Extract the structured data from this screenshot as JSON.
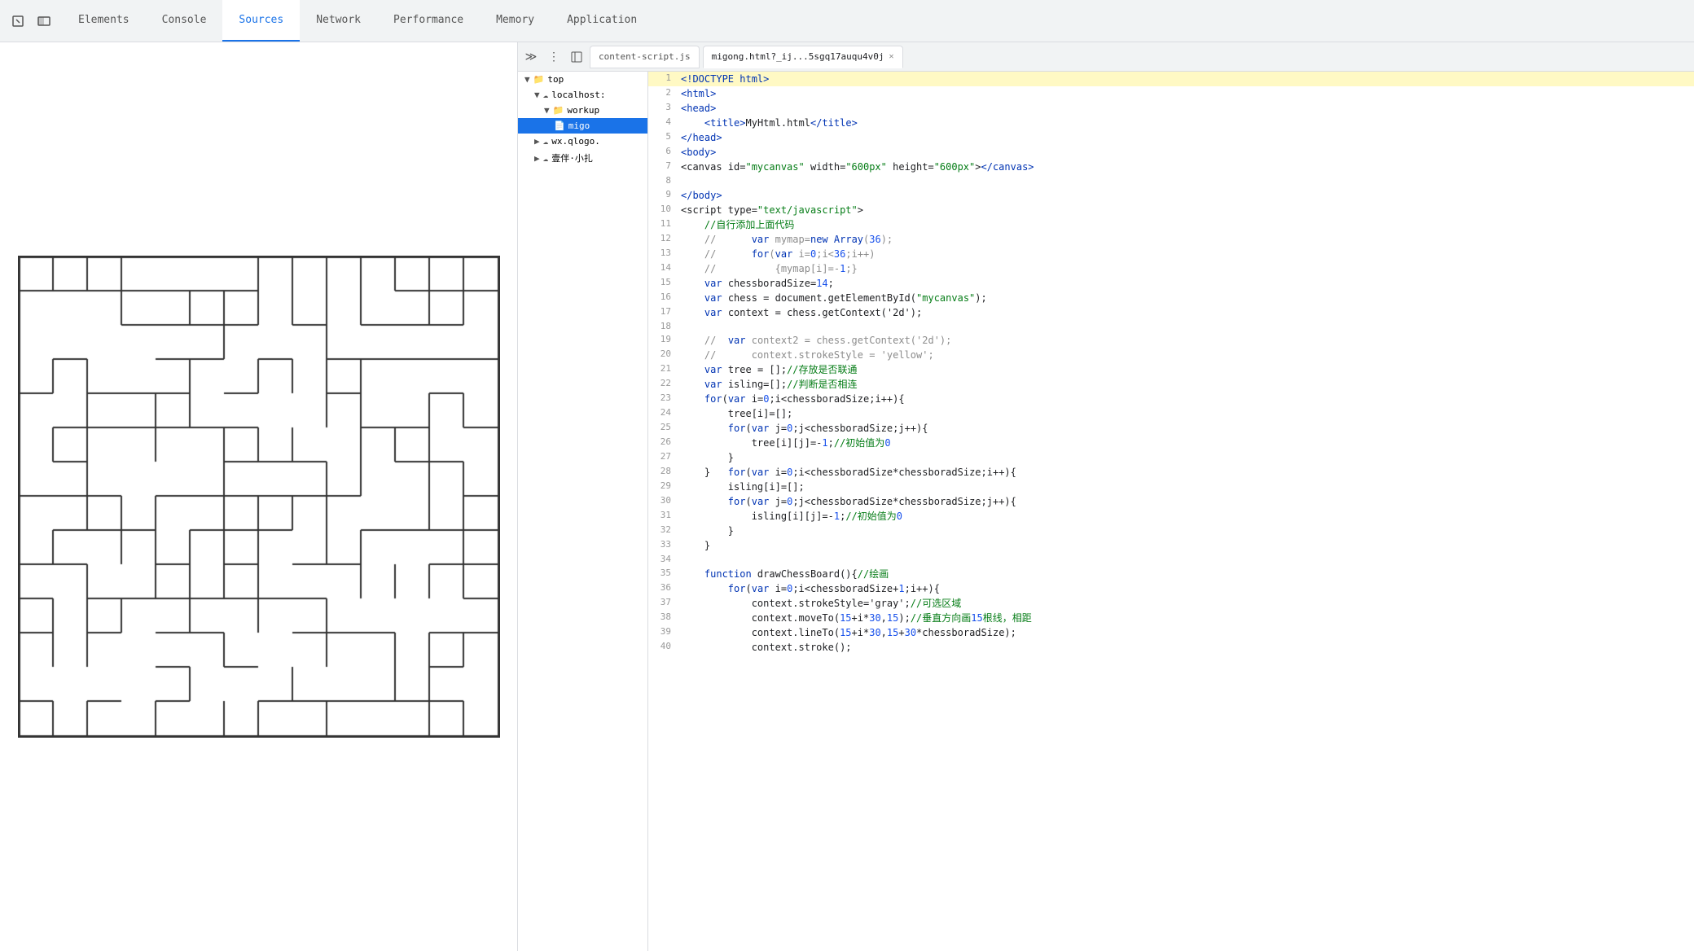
{
  "tabs": {
    "items": [
      {
        "label": "Elements",
        "active": false
      },
      {
        "label": "Console",
        "active": false
      },
      {
        "label": "Sources",
        "active": true
      },
      {
        "label": "Network",
        "active": false
      },
      {
        "label": "Performance",
        "active": false
      },
      {
        "label": "Memory",
        "active": false
      },
      {
        "label": "Application",
        "active": false
      }
    ]
  },
  "sources": {
    "file_tabs": [
      {
        "label": "content-script.js",
        "active": false
      },
      {
        "label": "migong.html?_ij...5sgq17auqu4v0j",
        "active": true,
        "closeable": true
      }
    ],
    "tree": {
      "items": [
        {
          "label": "top",
          "indent": 1,
          "icon": "▶",
          "type": "folder"
        },
        {
          "label": "localhost:",
          "indent": 2,
          "icon": "☁",
          "type": "network"
        },
        {
          "label": "workup",
          "indent": 3,
          "icon": "📁",
          "type": "folder"
        },
        {
          "label": "migo",
          "indent": 4,
          "icon": "📄",
          "type": "file",
          "selected": true
        },
        {
          "label": "wx.qlogo.",
          "indent": 2,
          "icon": "☁",
          "type": "network"
        },
        {
          "label": "壹伴·小扎",
          "indent": 2,
          "icon": "☁",
          "type": "network"
        }
      ]
    }
  },
  "code": {
    "lines": [
      {
        "num": 1,
        "content": "<!DOCTYPE html>",
        "highlight": true
      },
      {
        "num": 2,
        "content": "<html>"
      },
      {
        "num": 3,
        "content": "<head>"
      },
      {
        "num": 4,
        "content": "    <title>MyHtml.html</title>"
      },
      {
        "num": 5,
        "content": "</head>"
      },
      {
        "num": 6,
        "content": "<body>"
      },
      {
        "num": 7,
        "content": "<canvas id=\"mycanvas\" width=\"600px\" height=\"600px\"></canvas>"
      },
      {
        "num": 8,
        "content": ""
      },
      {
        "num": 9,
        "content": "</body>"
      },
      {
        "num": 10,
        "content": "<script type=\"text/javascript\">"
      },
      {
        "num": 11,
        "content": "    //自行添加上面代码"
      },
      {
        "num": 12,
        "content": "    //      var mymap=new Array(36);"
      },
      {
        "num": 13,
        "content": "    //      for(var i=0;i<36;i++)"
      },
      {
        "num": 14,
        "content": "    //          {mymap[i]=-1;}"
      },
      {
        "num": 15,
        "content": "    var chessboradSize=14;"
      },
      {
        "num": 16,
        "content": "    var chess = document.getElementById(\"mycanvas\");"
      },
      {
        "num": 17,
        "content": "    var context = chess.getContext('2d');"
      },
      {
        "num": 18,
        "content": ""
      },
      {
        "num": 19,
        "content": "    //  var context2 = chess.getContext('2d');"
      },
      {
        "num": 20,
        "content": "    //      context.strokeStyle = 'yellow';"
      },
      {
        "num": 21,
        "content": "    var tree = [];//存放是否联通"
      },
      {
        "num": 22,
        "content": "    var isling=[];//判断是否相连"
      },
      {
        "num": 23,
        "content": "    for(var i=0;i<chessboradSize;i++){"
      },
      {
        "num": 24,
        "content": "        tree[i]=[];"
      },
      {
        "num": 25,
        "content": "        for(var j=0;j<chessboradSize;j++){"
      },
      {
        "num": 26,
        "content": "            tree[i][j]=-1;//初始值为0"
      },
      {
        "num": 27,
        "content": "        }"
      },
      {
        "num": 28,
        "content": "    }   for(var i=0;i<chessboradSize*chessboradSize;i++){"
      },
      {
        "num": 29,
        "content": "        isling[i]=[];"
      },
      {
        "num": 30,
        "content": "        for(var j=0;j<chessboradSize*chessboradSize;j++){"
      },
      {
        "num": 31,
        "content": "            isling[i][j]=-1;//初始值为0"
      },
      {
        "num": 32,
        "content": "        }"
      },
      {
        "num": 33,
        "content": "    }"
      },
      {
        "num": 34,
        "content": ""
      },
      {
        "num": 35,
        "content": "    function drawChessBoard(){//绘画"
      },
      {
        "num": 36,
        "content": "        for(var i=0;i<chessboradSize+1;i++){"
      },
      {
        "num": 37,
        "content": "            context.strokeStyle='gray';//可选区域"
      },
      {
        "num": 38,
        "content": "            context.moveTo(15+i*30,15);//垂直方向画15根线，相距"
      },
      {
        "num": 39,
        "content": "            context.lineTo(15+i*30,15+30*chessboradSize);"
      },
      {
        "num": 40,
        "content": "            context.stroke();"
      }
    ]
  }
}
